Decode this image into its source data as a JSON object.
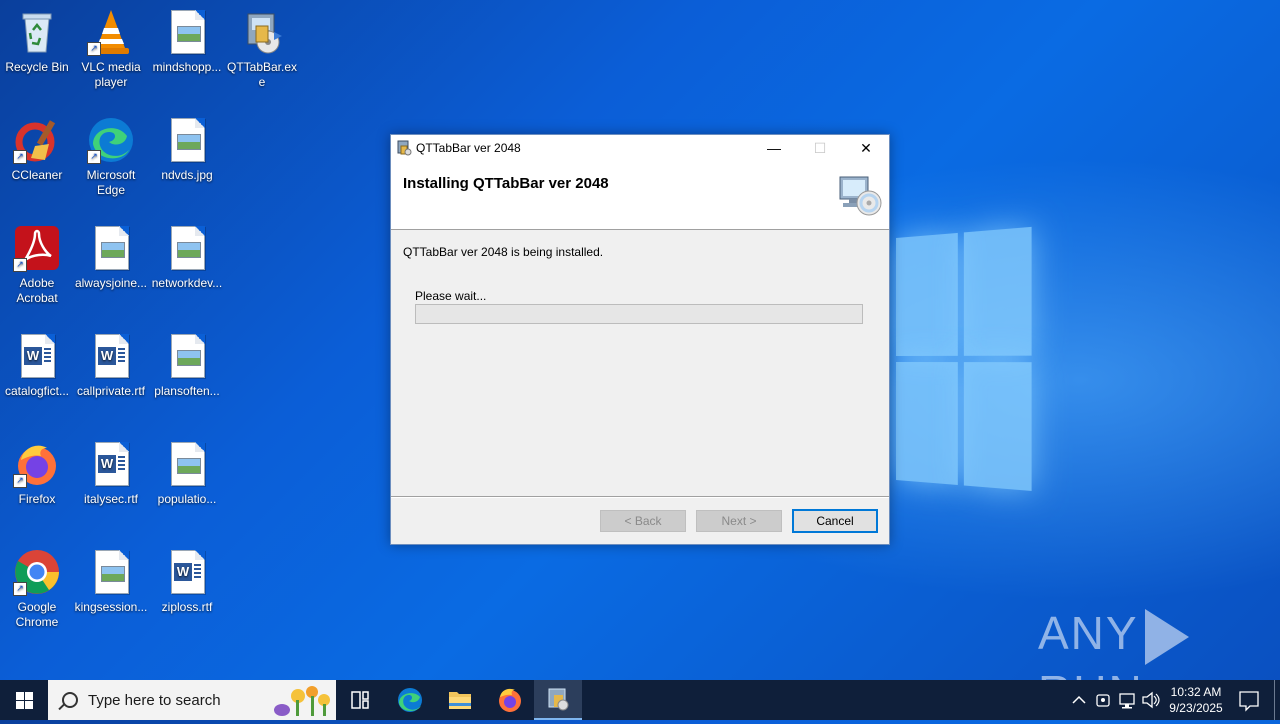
{
  "desktop": {
    "icons": [
      {
        "label": "Recycle Bin",
        "icon": "recycle-bin-icon"
      },
      {
        "label": "VLC media player",
        "icon": "vlc-icon"
      },
      {
        "label": "mindshopp...",
        "icon": "image-file-icon"
      },
      {
        "label": "QTTabBar.exe",
        "icon": "installer-icon"
      },
      {
        "label": "CCleaner",
        "icon": "ccleaner-icon"
      },
      {
        "label": "Microsoft Edge",
        "icon": "edge-icon"
      },
      {
        "label": "ndvds.jpg",
        "icon": "image-file-icon"
      },
      {
        "label": "Adobe Acrobat",
        "icon": "acrobat-icon"
      },
      {
        "label": "alwaysjoine...",
        "icon": "image-file-icon"
      },
      {
        "label": "networkdev...",
        "icon": "image-file-icon"
      },
      {
        "label": "catalogfict...",
        "icon": "word-file-icon"
      },
      {
        "label": "callprivate.rtf",
        "icon": "word-file-icon"
      },
      {
        "label": "plansoften...",
        "icon": "image-file-icon"
      },
      {
        "label": "Firefox",
        "icon": "firefox-icon"
      },
      {
        "label": "italysec.rtf",
        "icon": "word-file-icon"
      },
      {
        "label": "populatio...",
        "icon": "image-file-icon"
      },
      {
        "label": "Google Chrome",
        "icon": "chrome-icon"
      },
      {
        "label": "kingsession...",
        "icon": "image-file-icon"
      },
      {
        "label": "ziploss.rtf",
        "icon": "word-file-icon"
      }
    ]
  },
  "installer": {
    "window_title": "QTTabBar ver 2048",
    "heading": "Installing QTTabBar ver 2048",
    "status_text": "QTTabBar ver 2048 is being installed.",
    "wait_label": "Please wait...",
    "progress": 0,
    "buttons": {
      "back": "< Back",
      "next": "Next >",
      "cancel": "Cancel"
    },
    "controls": {
      "minimize": "—",
      "maximize": "☐",
      "close": "✕"
    }
  },
  "watermark": {
    "left": "ANY",
    "right": "RUN"
  },
  "taskbar": {
    "search_placeholder": "Type here to search",
    "pinned": [
      "task-view-icon",
      "edge-icon",
      "file-explorer-icon",
      "firefox-icon",
      "installer-icon"
    ],
    "clock": {
      "time": "10:32 AM",
      "date": "9/23/2025"
    }
  },
  "colors": {
    "accent": "#0078d7",
    "taskbar": "#0f1f3a",
    "desktop": "#0b5ed7"
  }
}
